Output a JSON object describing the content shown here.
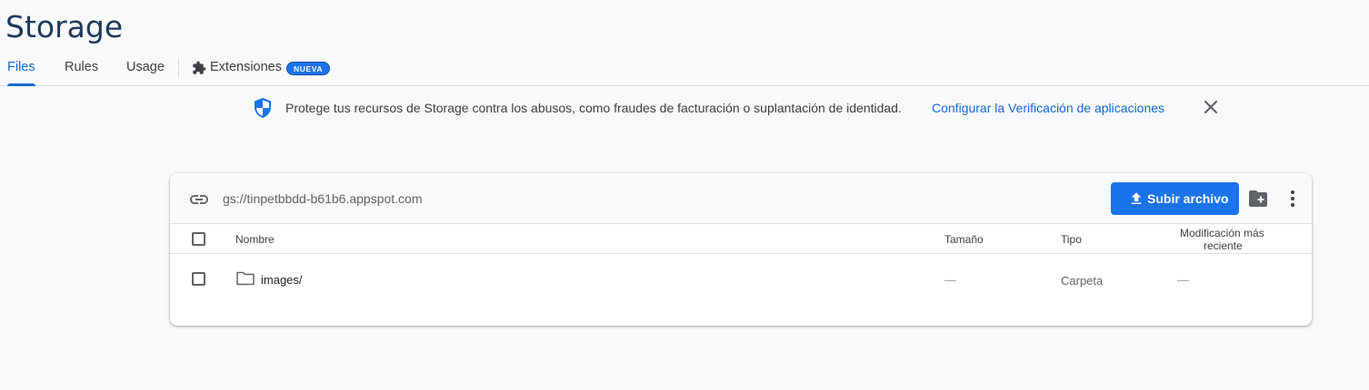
{
  "page": {
    "title": "Storage"
  },
  "tabs": [
    {
      "label": "Files",
      "active": true
    },
    {
      "label": "Rules"
    },
    {
      "label": "Usage"
    },
    {
      "label": "Extensiones",
      "badge": "NUEVA",
      "icon": "extension-icon"
    }
  ],
  "banner": {
    "icon": "shield-icon",
    "text": "Protege tus recursos de Storage contra los abusos, como fraudes de facturación o suplantación de identidad.",
    "link": "Configurar la Verificación de aplicaciones",
    "close_icon": "close-icon"
  },
  "bucket": {
    "path": "gs://tinpetbbdd-b61b6.appspot.com",
    "upload_label": "Subir archivo",
    "icons": {
      "link": "link-icon",
      "upload": "upload-icon",
      "new_folder": "create-folder-icon",
      "more": "more-vert-icon"
    }
  },
  "table": {
    "columns": [
      "Nombre",
      "Tamaño",
      "Tipo",
      "Modificación más",
      "reciente"
    ],
    "rows": [
      {
        "name": "images/",
        "size": "—",
        "type": "Carpeta",
        "modified": "—",
        "icon": "folder-icon"
      }
    ]
  },
  "colors": {
    "accent": "#1a73e8",
    "title": "#1f3a5a"
  }
}
